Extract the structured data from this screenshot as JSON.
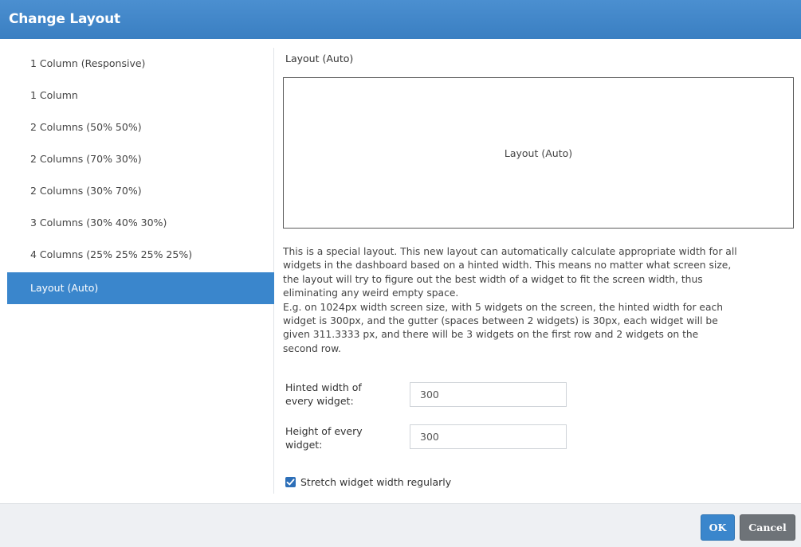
{
  "dialog": {
    "title": "Change Layout"
  },
  "sidebar": {
    "items": [
      {
        "label": "1 Column (Responsive)",
        "selected": false
      },
      {
        "label": "1 Column",
        "selected": false
      },
      {
        "label": "2 Columns (50% 50%)",
        "selected": false
      },
      {
        "label": "2 Columns (70% 30%)",
        "selected": false
      },
      {
        "label": "2 Columns (30% 70%)",
        "selected": false
      },
      {
        "label": "3 Columns (30% 40% 30%)",
        "selected": false
      },
      {
        "label": "4 Columns (25% 25% 25% 25%)",
        "selected": false
      },
      {
        "label": "Layout (Auto)",
        "selected": true
      }
    ]
  },
  "main": {
    "section_title": "Layout (Auto)",
    "preview_label": "Layout (Auto)",
    "description_lines": [
      "This is a special layout. This new layout can automatically calculate appropriate width for all",
      "widgets in the dashboard based on a hinted width. This means no matter what screen size,",
      "the layout will try to figure out the best width of a widget to fit the screen width, thus",
      "eliminating any weird empty space.",
      "E.g. on 1024px width screen size, with 5 widgets on the screen, the hinted width for each",
      "widget is 300px, and the gutter (spaces between 2 widgets) is 30px, each widget will be",
      "given 311.3333 px, and there will be 3 widgets on the first row and 2 widgets on the",
      "second row."
    ],
    "hinted_width": {
      "label_line1": "Hinted width of",
      "label_line2": "every widget:",
      "value": "300"
    },
    "height": {
      "label_line1": "Height of every",
      "label_line2": "widget:",
      "value": "300"
    },
    "stretch": {
      "label": "Stretch widget width regularly",
      "checked": true
    }
  },
  "footer": {
    "ok_label": "OK",
    "cancel_label": "Cancel"
  },
  "colors": {
    "accent": "#3a86cc",
    "cancel": "#6e7378"
  }
}
